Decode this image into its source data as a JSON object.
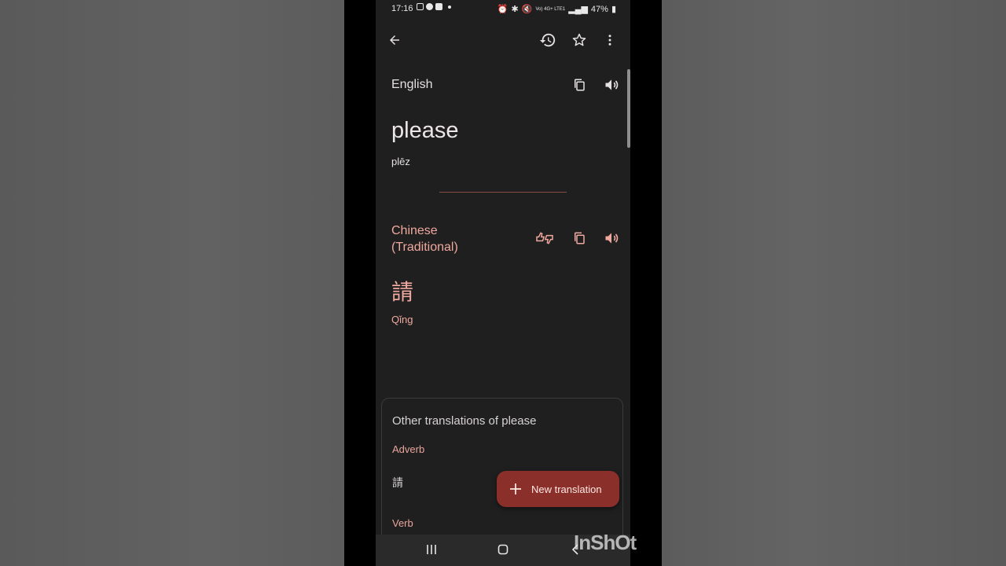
{
  "status_bar": {
    "time": "17:16",
    "signal_label": "Vo) 4G+ LTE1",
    "battery": "47%"
  },
  "topbar": {
    "back_icon": "arrow-left-icon",
    "history_icon": "history-icon",
    "star_icon": "star-outline-icon",
    "menu_icon": "more-vert-icon"
  },
  "source": {
    "language": "English",
    "text": "please",
    "transliteration": "plēz"
  },
  "target": {
    "language_line1": "Chinese",
    "language_line2": "(Traditional)",
    "text": "請",
    "transliteration": "Qǐng"
  },
  "other_translations": {
    "title": "Other translations of please",
    "adverb_label": "Adverb",
    "adverb_item": "請",
    "verb_label": "Verb"
  },
  "fab": {
    "label": "New translation"
  },
  "watermark": "InShOt",
  "colors": {
    "accent": "#f0a99f",
    "fab_bg": "#8a2f2a",
    "screen_bg": "#1f1f1f"
  }
}
